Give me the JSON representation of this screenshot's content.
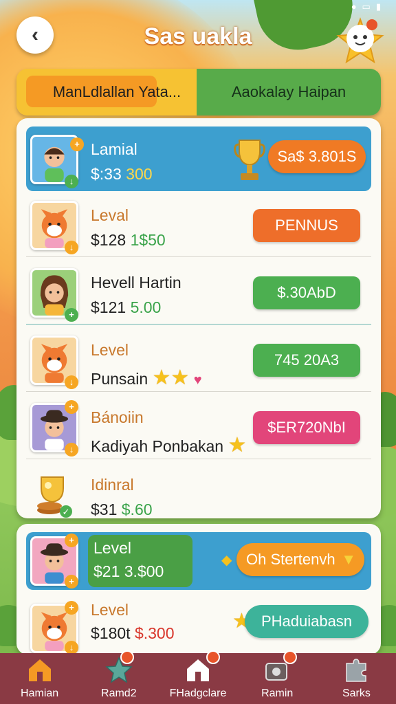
{
  "app": {
    "title": "Sas uakla"
  },
  "tabs": [
    {
      "label": "ManLdlallan Yata...",
      "active": true
    },
    {
      "label": "Aaokalay Haipan",
      "active": false
    }
  ],
  "rows": [
    {
      "name": "Lamial",
      "value_prefix": "$:33",
      "value": "300",
      "action": "Sa$ 3.801S",
      "highlighted": true
    },
    {
      "name": "Leval",
      "value_prefix": "$128",
      "value": "1$50",
      "action": "PENNUS"
    },
    {
      "name": "Hevell Hartin",
      "value_prefix": "$121",
      "value": "5.00",
      "action": "$.30AbD"
    },
    {
      "name": "Level",
      "value_prefix": "Punsain",
      "value": "",
      "action": "745 20A3"
    },
    {
      "name": "Bánoiin",
      "value_prefix": "Kadiyah Ponbakan",
      "value": "",
      "action": "$ER720NbI"
    },
    {
      "name": "Idinral",
      "value_prefix": "$31",
      "value": "$.60",
      "action": ""
    }
  ],
  "bottom_rows": [
    {
      "name": "Level",
      "value_prefix": "$21",
      "value": "3.$00",
      "action": "Oh Stertenvh",
      "highlighted": true
    },
    {
      "name": "Level",
      "value_prefix": "$180t",
      "value": "$.300",
      "action": "PHaduiabasn"
    }
  ],
  "nav": [
    {
      "label": "Hamian",
      "icon": "home-icon"
    },
    {
      "label": "Ramd2",
      "icon": "star-icon"
    },
    {
      "label": "FHadgclare",
      "icon": "house-icon"
    },
    {
      "label": "Ramin",
      "icon": "camera-icon"
    },
    {
      "label": "Sarks",
      "icon": "puzzle-icon"
    }
  ],
  "colors": {
    "orange": "#f07a24",
    "green": "#4caf50",
    "pink": "#e2457a",
    "teal": "#3db39a",
    "blue": "#3d9fcf",
    "nav": "#8a3a44"
  }
}
